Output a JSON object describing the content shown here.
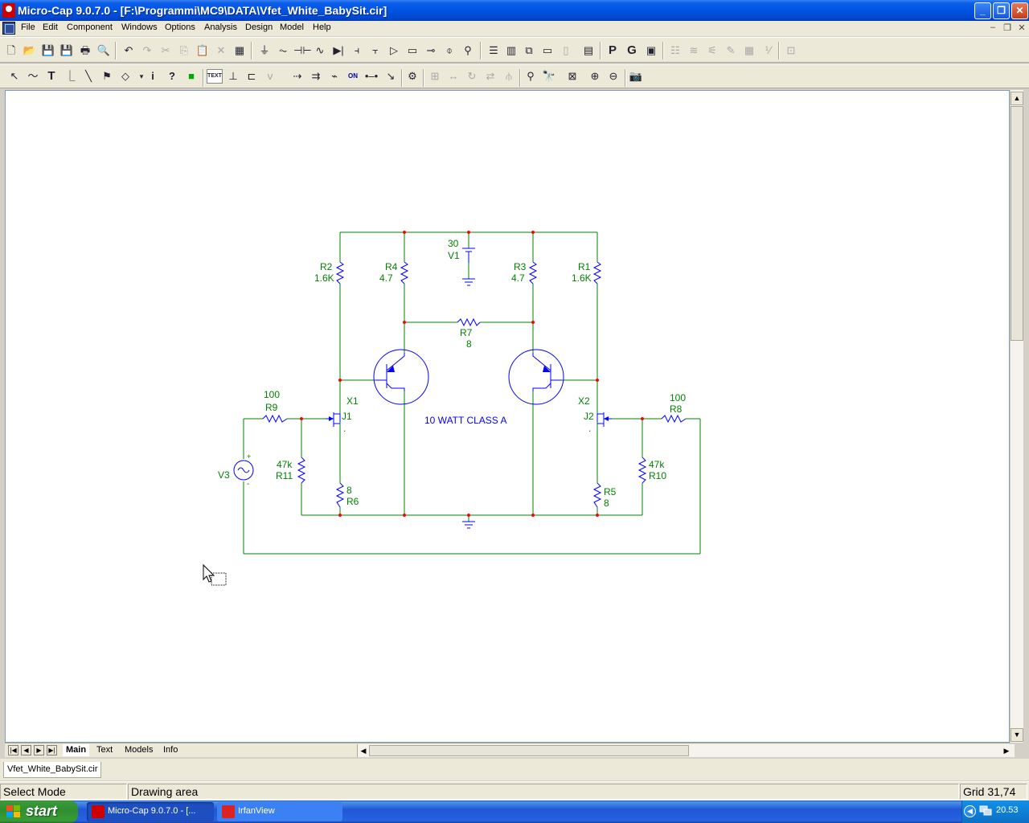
{
  "window": {
    "title": "Micro-Cap 9.0.7.0 - [F:\\Programmi\\MC9\\DATA\\Vfet_White_BabySit.cir]",
    "buttons": {
      "minimize": "_",
      "restore": "❐",
      "close": "✕"
    }
  },
  "menu": [
    "File",
    "Edit",
    "Component",
    "Windows",
    "Options",
    "Analysis",
    "Design",
    "Model",
    "Help"
  ],
  "mdi_controls": [
    "–",
    "❐",
    "✕"
  ],
  "toolbar1": {
    "file_icons": [
      "new-file-icon",
      "open-folder-icon",
      "save-icon",
      "save-all-icon",
      "print-icon",
      "print-preview-icon"
    ],
    "edit_icons": [
      "undo-icon",
      "redo-icon",
      "cut-icon",
      "copy-icon",
      "paste-icon",
      "delete-icon",
      "select-all-icon"
    ],
    "component_icons": [
      "ground-icon",
      "resistor-icon",
      "capacitor-icon",
      "inductor-icon",
      "diode-icon",
      "battery-icon",
      "transistor-icon",
      "opamp-icon",
      "source-icon"
    ],
    "window_icons": [
      "tile-horizontal-icon",
      "tile-vertical-icon",
      "cascade-icon",
      "window-icon",
      "split-icon",
      "calculator-icon"
    ],
    "letters": [
      "P",
      "G"
    ],
    "disabled_icons": [
      "settings-icon",
      "waveform-icon",
      "probe-icon",
      "edit-pen-icon",
      "grid-icon",
      "value-icon",
      "zoom-fit-icon"
    ]
  },
  "toolbar2": {
    "mode_icons": [
      "select-arrow-icon",
      "wire-icon",
      "text-tool-icon",
      "orthogonal-wire-icon",
      "diagonal-wire-icon",
      "flag-icon",
      "shapes-icon",
      "info-icon",
      "help-icon",
      "color-icon"
    ],
    "text_tool_label": "TEXT",
    "edit_icons": [
      "node-numbers-icon",
      "pin-icon",
      "voltage-icon",
      "current-icon",
      "on-off-icon",
      "line-icon",
      "cursor-icon",
      "properties-icon"
    ],
    "transform_icons": [
      "box-icon",
      "mirror-icon",
      "rotate-icon",
      "flip-icon",
      "step-icon"
    ],
    "find_icons": [
      "go-icon",
      "find-icon",
      "title-block-icon",
      "zoom-in-icon",
      "zoom-out-icon",
      "camera-icon"
    ]
  },
  "schematic": {
    "annotation": "10 WATT CLASS A",
    "labels": {
      "r2_name": "R2",
      "r2_value": "1.6K",
      "r4_name": "R4",
      "r4_value": "4.7",
      "v1_value": "30",
      "v1_name": "V1",
      "r3_name": "R3",
      "r3_value": "4.7",
      "r1_name": "R1",
      "r1_value": "1.6K",
      "r7_name": "R7",
      "r7_value": "8",
      "x1_name": "X1",
      "x2_name": "X2",
      "r9_value": "100",
      "r9_name": "R9",
      "r8_value": "100",
      "r8_name": "R8",
      "j1_name": "J1",
      "j2_name": "J2",
      "v3_name": "V3",
      "v3_plus": "+",
      "v3_minus": "-",
      "r11_value": "47k",
      "r11_name": "R11",
      "r10_value": "47k",
      "r10_name": "R10",
      "r6_value": "8",
      "r6_name": "R6",
      "r5_name": "R5",
      "r5_value": "8",
      "j1_dot": ".",
      "j2_dot": "."
    },
    "colors": {
      "wire": "#008000",
      "component": "#0000ff",
      "text": "#008000",
      "annotation": "#0000ff",
      "node": "#ff0000"
    }
  },
  "sheet_tabs": [
    "Main",
    "Text",
    "Models",
    "Info"
  ],
  "active_sheet": "Main",
  "document_tab": "Vfet_White_BabySit.cir",
  "status": {
    "mode": "Select Mode",
    "area": "Drawing area",
    "grid": "Grid 31,74"
  },
  "taskbar": {
    "start": "start",
    "items": [
      "Micro-Cap 9.0.7.0 - [...",
      "IrfanView"
    ],
    "clock": "20.53"
  }
}
